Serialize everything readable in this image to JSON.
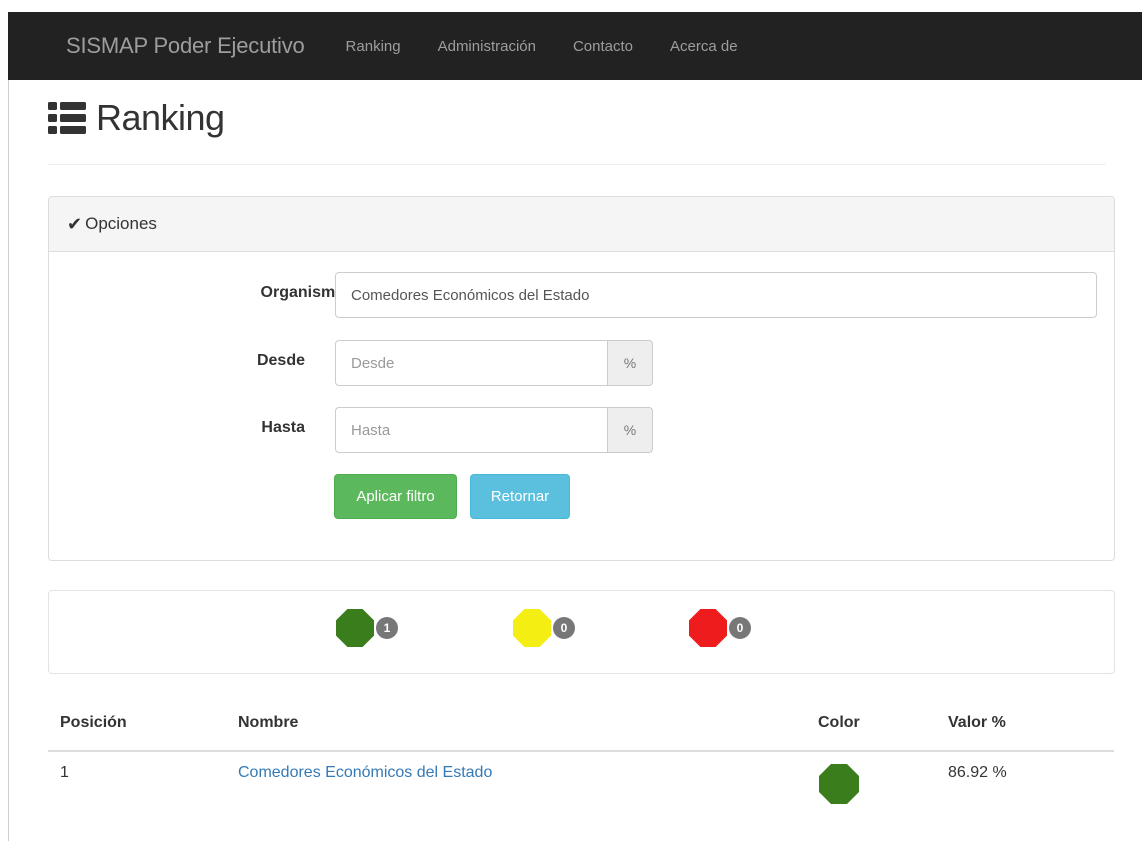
{
  "navbar": {
    "brand": "SISMAP Poder Ejecutivo",
    "links": [
      "Ranking",
      "Administración",
      "Contacto",
      "Acerca de"
    ]
  },
  "page": {
    "title": "Ranking",
    "title_icon": "list-icon"
  },
  "options_panel": {
    "heading": "Opciones",
    "heading_icon": "check-icon",
    "organismo_label": "Organismo",
    "organismo_value": "Comedores Económicos del Estado",
    "desde_label": "Desde",
    "desde_placeholder": "Desde",
    "hasta_label": "Hasta",
    "hasta_placeholder": "Hasta",
    "percent_addon": "%",
    "apply_button": "Aplicar filtro",
    "reset_button": "Retornar"
  },
  "legend": [
    {
      "color": "#3a7d1c",
      "count": "1"
    },
    {
      "color": "#f4ee13",
      "count": "0"
    },
    {
      "color": "#ee1c1c",
      "count": "0"
    }
  ],
  "table": {
    "headers": [
      "Posición",
      "Nombre",
      "Color",
      "Valor %"
    ],
    "rows": [
      {
        "position": "1",
        "name": "Comedores Económicos del Estado",
        "color": "#3a7d1c",
        "value": "86.92  %"
      }
    ]
  }
}
